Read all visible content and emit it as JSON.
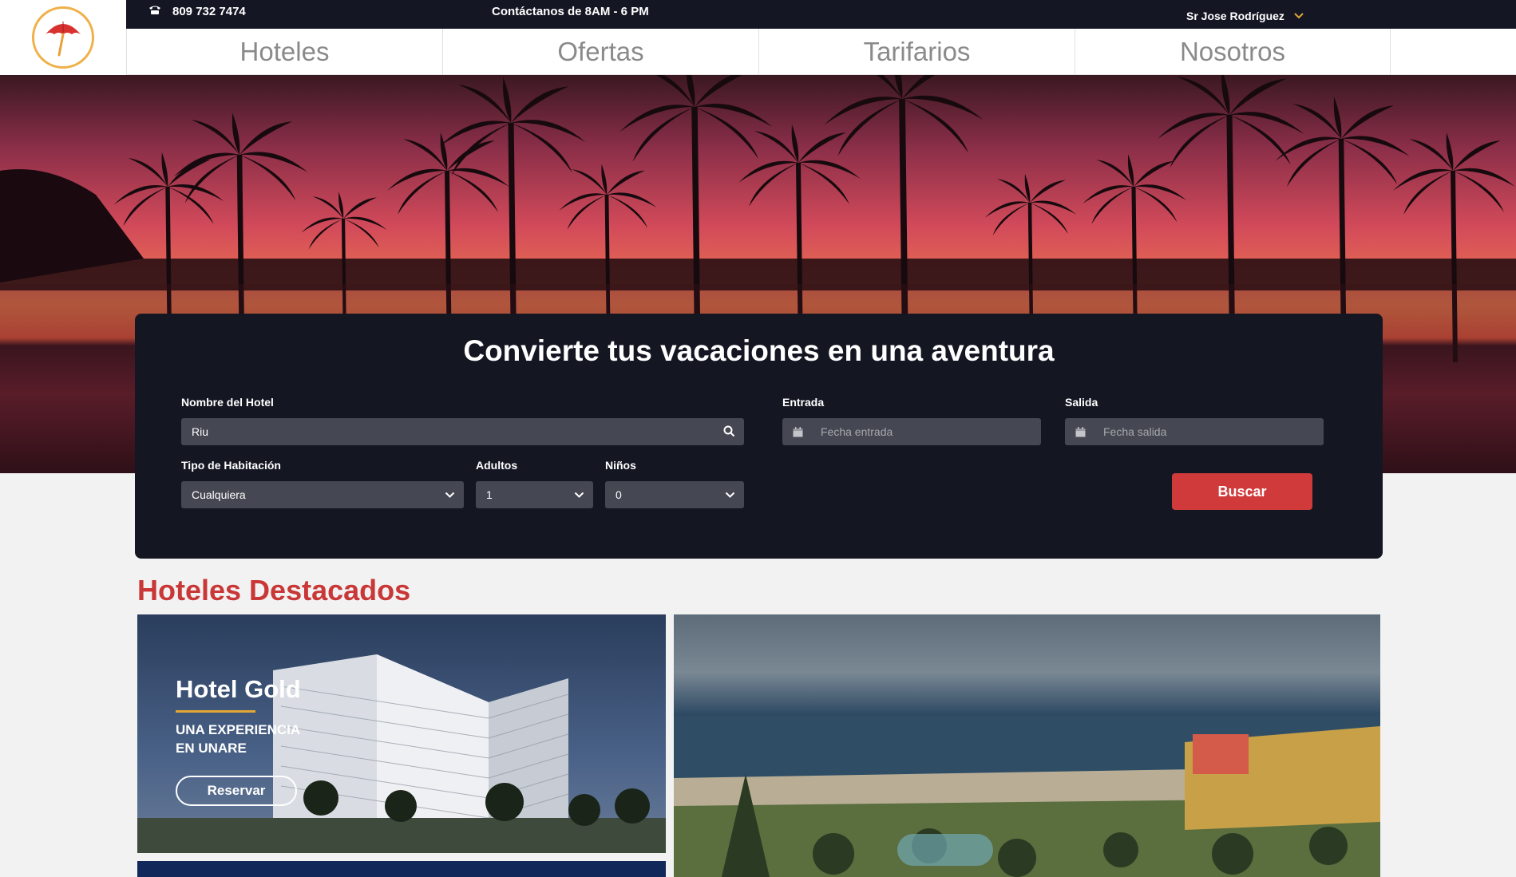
{
  "topbar": {
    "phone": "809 732 7474",
    "contact_hours": "Contáctanos de 8AM - 6 PM",
    "user_name": "Sr Jose Rodríguez"
  },
  "nav": {
    "items": [
      {
        "label": "Hoteles"
      },
      {
        "label": "Ofertas"
      },
      {
        "label": "Tarifarios"
      },
      {
        "label": "Nosotros"
      }
    ]
  },
  "search": {
    "title": "Convierte tus vacaciones en una aventura",
    "hotel_label": "Nombre del Hotel",
    "hotel_value": "Riu",
    "checkin_label": "Entrada",
    "checkin_placeholder": "Fecha entrada",
    "checkout_label": "Salida",
    "checkout_placeholder": "Fecha salida",
    "room_label": "Tipo de Habitación",
    "room_value": "Cualquiera",
    "adults_label": "Adultos",
    "adults_value": "1",
    "kids_label": "Niños",
    "kids_value": "0",
    "submit_label": "Buscar"
  },
  "featured": {
    "title": "Hoteles Destacados",
    "hotels": [
      {
        "name": "Hotel Gold",
        "tagline": "UNA EXPERIENCIA EN UNARE",
        "cta": "Reservar"
      }
    ]
  },
  "colors": {
    "topbar": "#141624",
    "accent_red": "#c93737",
    "button_red": "#d13a3a",
    "logo_ring": "#f0b048",
    "underline_gold": "#e3a736"
  },
  "icons": [
    "umbrella-logo",
    "phone-icon",
    "chevron-down-icon",
    "search-icon",
    "calendar-icon"
  ]
}
